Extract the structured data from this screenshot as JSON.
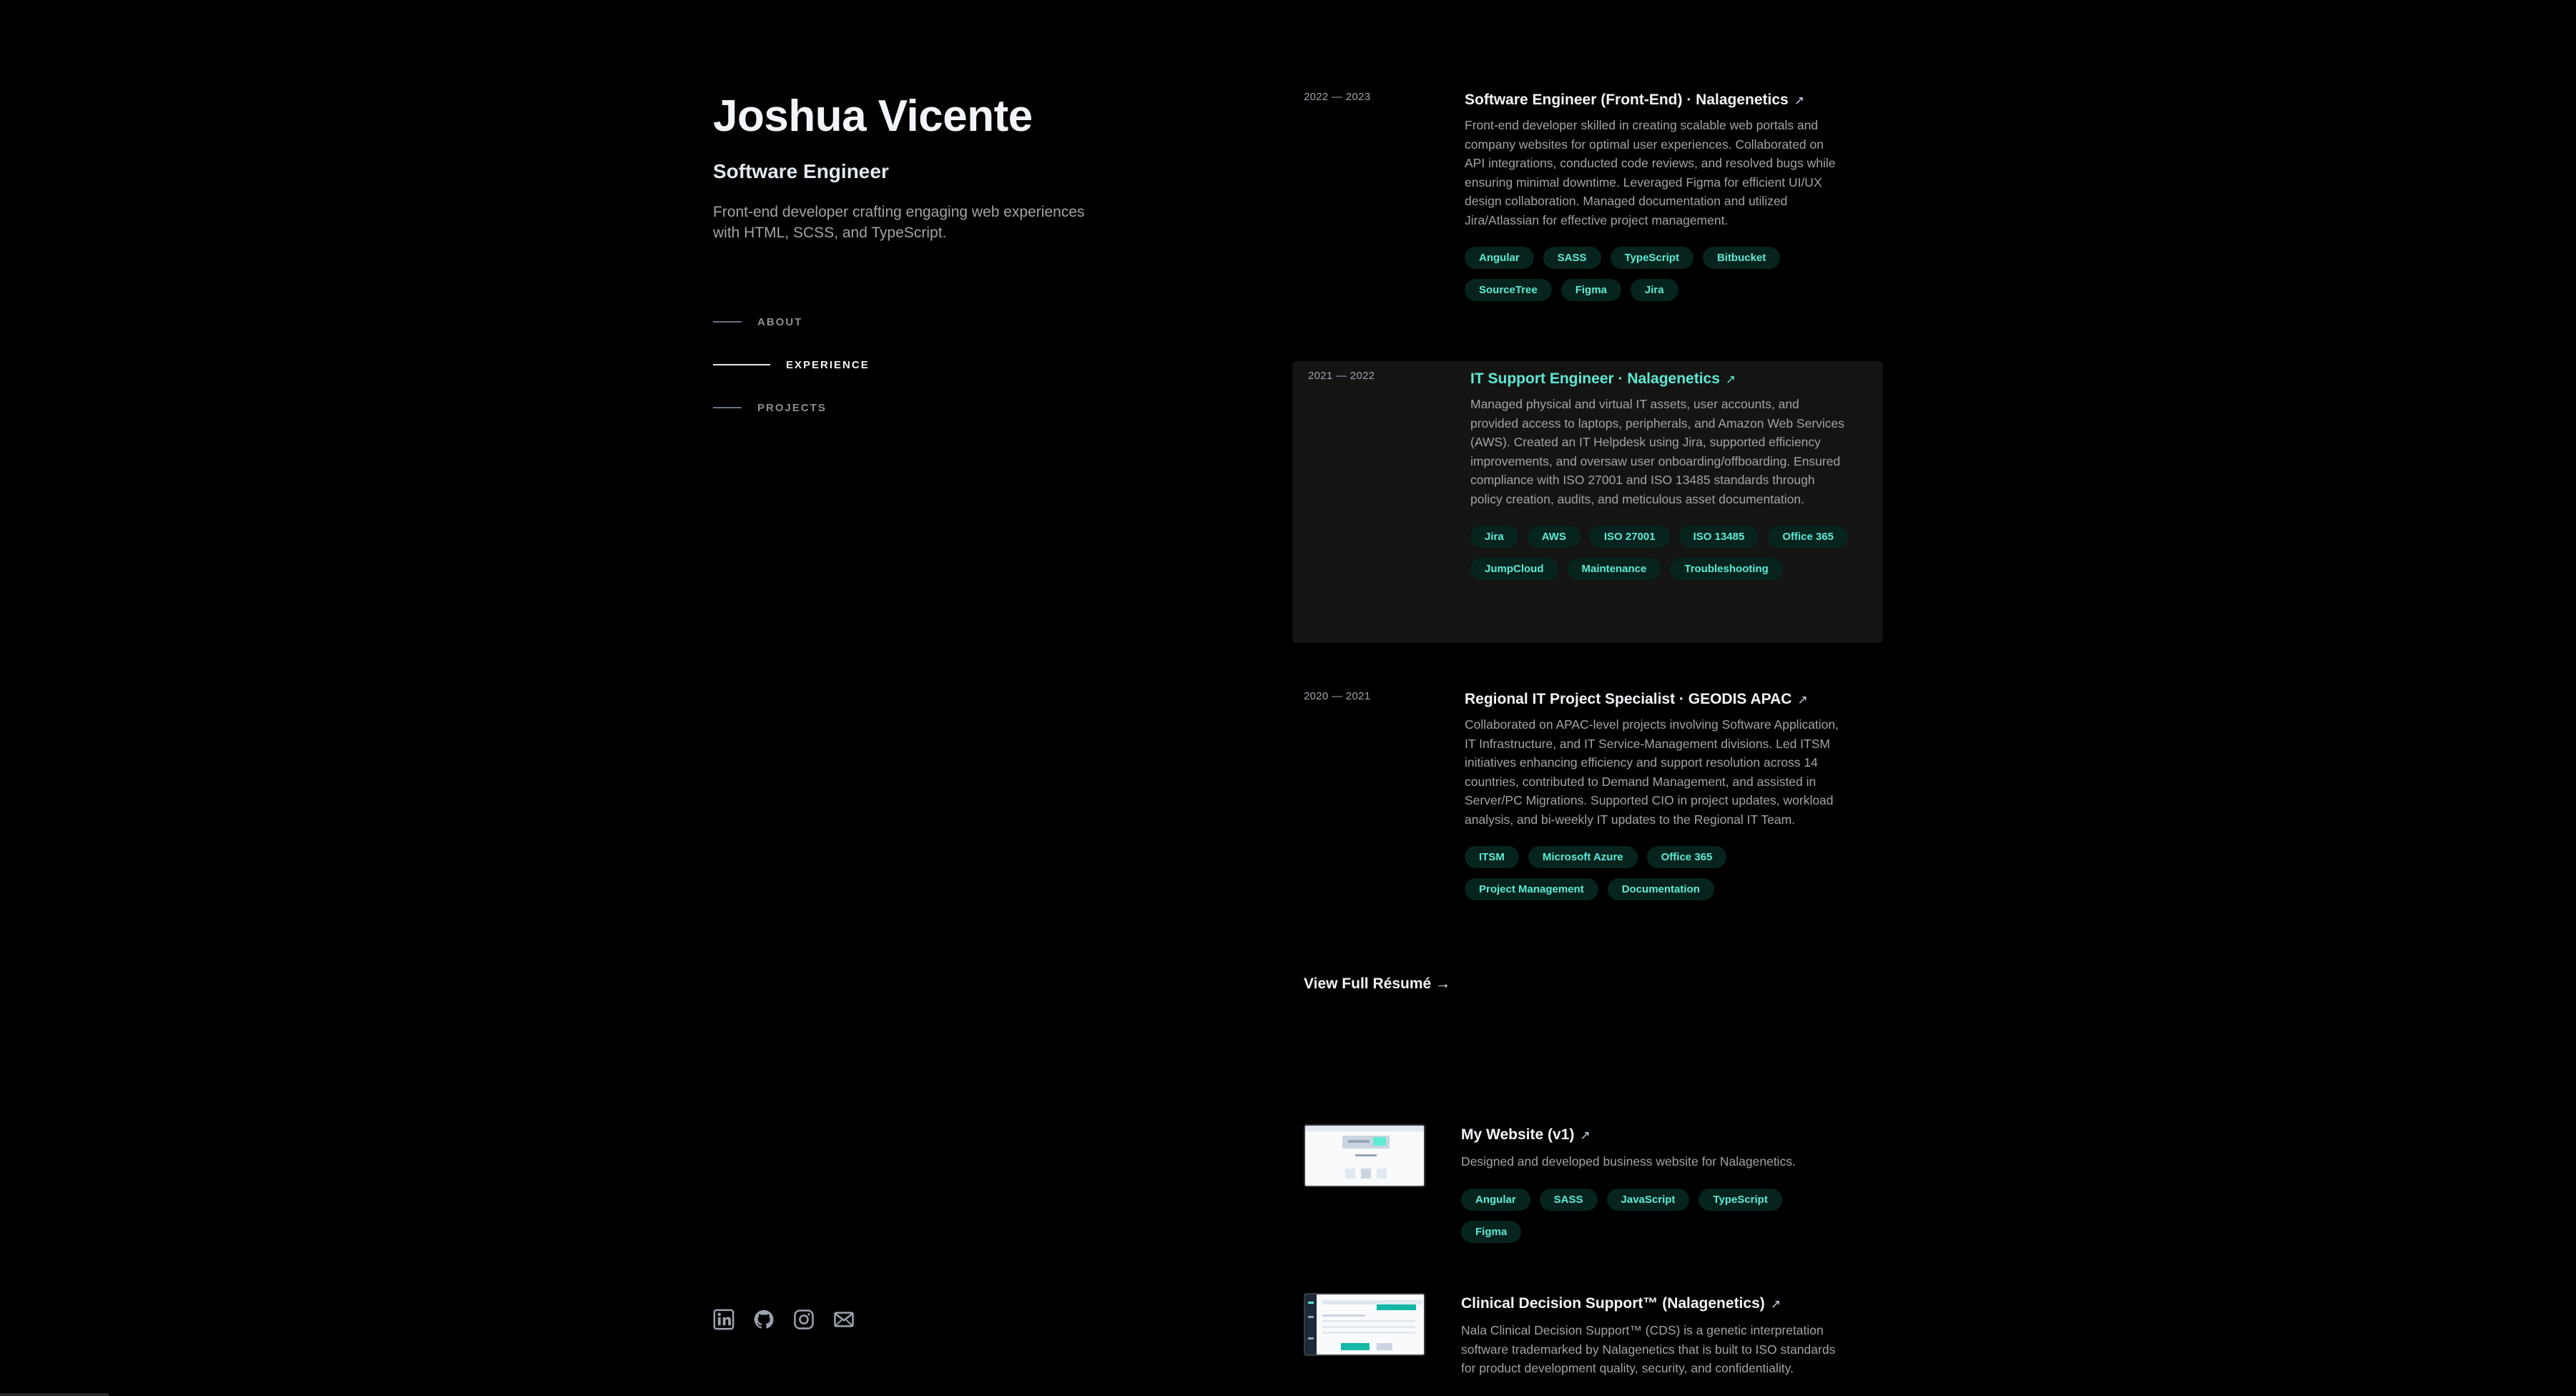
{
  "profile": {
    "name": "Joshua Vicente",
    "role": "Software Engineer",
    "tagline": "Front-end developer crafting engaging web experiences with HTML, SCSS, and TypeScript."
  },
  "nav": {
    "items": [
      {
        "label": "ABOUT",
        "active": false
      },
      {
        "label": "EXPERIENCE",
        "active": true
      },
      {
        "label": "PROJECTS",
        "active": false
      }
    ]
  },
  "socials": [
    "linkedin-icon",
    "github-icon",
    "instagram-icon",
    "mail-icon"
  ],
  "experience": [
    {
      "date": "2022 — 2023",
      "title": "Software Engineer (Front-End) · Nalagenetics",
      "arrow": "↗",
      "description": "Front-end developer skilled in creating scalable web portals and company websites for optimal user experiences. Collaborated on API integrations, conducted code reviews, and resolved bugs while ensuring minimal downtime. Leveraged Figma for efficient UI/UX design collaboration. Managed documentation and utilized Jira/Atlassian for effective project management.",
      "tags": [
        "Angular",
        "SASS",
        "TypeScript",
        "Bitbucket",
        "SourceTree",
        "Figma",
        "Jira"
      ]
    },
    {
      "date": "2021 — 2022",
      "title": "IT Support Engineer · Nalagenetics",
      "arrow": "↗",
      "description": "Managed physical and virtual IT assets, user accounts, and provided access to laptops, peripherals, and Amazon Web Services (AWS). Created an IT Helpdesk using Jira, supported efficiency improvements, and oversaw user onboarding/offboarding. Ensured compliance with ISO 27001 and ISO 13485 standards through policy creation, audits, and meticulous asset documentation.",
      "tags": [
        "Jira",
        "AWS",
        "ISO 27001",
        "ISO 13485",
        "Office 365",
        "JumpCloud",
        "Maintenance",
        "Troubleshooting"
      ]
    },
    {
      "date": "2020 — 2021",
      "title": "Regional IT Project Specialist · GEODIS APAC",
      "arrow": "↗",
      "description": "Collaborated on APAC-level projects involving Software Application, IT Infrastructure, and IT Service-Management divisions. Led ITSM initiatives enhancing efficiency and support resolution across 14 countries, contributed to Demand Management, and assisted in Server/PC Migrations. Supported CIO in project updates, workload analysis, and bi-weekly IT updates to the Regional IT Team.",
      "tags": [
        "ITSM",
        "Microsoft Azure",
        "Office 365",
        "Project Management",
        "Documentation"
      ]
    }
  ],
  "resume_link": "View Full Résumé →",
  "projects": [
    {
      "title": "My Website (v1)",
      "arrow": "↗",
      "description": "Designed and developed business website for Nalagenetics.",
      "tags": [
        "Angular",
        "SASS",
        "JavaScript",
        "TypeScript",
        "Figma"
      ]
    },
    {
      "title": "Clinical Decision Support™ (Nalagenetics)",
      "arrow": "↗",
      "description": "Nala Clinical Decision Support™ (CDS) is a genetic interpretation software trademarked by Nalagenetics that is built to ISO standards for product development quality, security, and confidentiality.",
      "tags": []
    }
  ]
}
